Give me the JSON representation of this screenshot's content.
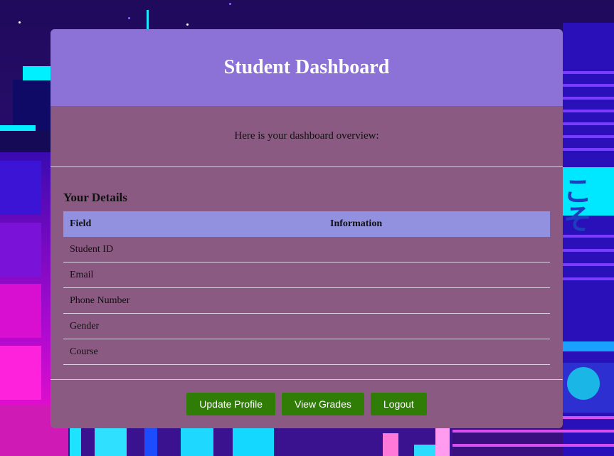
{
  "dashboard": {
    "title": "Student Dashboard",
    "overview_text": "Here is your dashboard overview:",
    "details": {
      "heading": "Your Details",
      "columns": [
        "Field",
        "Information"
      ],
      "rows": [
        {
          "field": "Student ID",
          "info": ""
        },
        {
          "field": "Email",
          "info": ""
        },
        {
          "field": "Phone Number",
          "info": ""
        },
        {
          "field": "Gender",
          "info": ""
        },
        {
          "field": "Course",
          "info": ""
        }
      ]
    },
    "buttons": {
      "update_profile": "Update Profile",
      "view_grades": "View Grades",
      "logout": "Logout"
    }
  },
  "background": {
    "sign_text": "こそ"
  },
  "colors": {
    "header_bg": "#8c72d6",
    "card_bg": "#8b5a82",
    "table_header_bg": "#9191e0",
    "button_bg": "#2f7d06"
  }
}
